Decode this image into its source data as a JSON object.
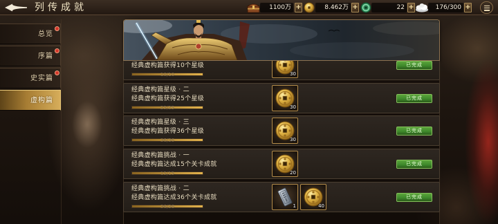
{
  "header": {
    "title": "列传成就",
    "back_icon": "back-arrow-icon",
    "menu_icon": "menu-icon",
    "plus_label": "+",
    "resources": [
      {
        "icon": "chest-icon",
        "value": "1100万"
      },
      {
        "icon": "gold-coin-icon",
        "value": "8.462万"
      },
      {
        "icon": "jade-icon",
        "value": "22"
      },
      {
        "icon": "provisions-icon",
        "value": "176/300"
      }
    ]
  },
  "sidebar": {
    "selected_index": 3,
    "tabs": [
      {
        "label": "总览",
        "has_notification": true
      },
      {
        "label": "序篇",
        "has_notification": true
      },
      {
        "label": "史实篇",
        "has_notification": true
      },
      {
        "label": "虚构篇",
        "has_notification": false
      }
    ]
  },
  "banner": {
    "icon": "hero-portrait"
  },
  "achievements": [
    {
      "description": "经典虚构篇获得10个星级",
      "progress": "10/10",
      "progress_fraction": 1,
      "rewards": [
        {
          "icon": "coin-icon",
          "count": "30"
        }
      ],
      "status": "已完成"
    },
    {
      "title": "经典虚构篇星级 · 二",
      "description": "经典虚构篇获得25个星级",
      "progress": "25/25",
      "progress_fraction": 1,
      "rewards": [
        {
          "icon": "coin-icon",
          "count": "30"
        }
      ],
      "status": "已完成"
    },
    {
      "title": "经典虚构篇星级 · 三",
      "description": "经典虚构篇获得36个星级",
      "progress": "36/36",
      "progress_fraction": 1,
      "rewards": [
        {
          "icon": "coin-icon",
          "count": "30"
        }
      ],
      "status": "已完成"
    },
    {
      "title": "经典虚构篇挑战 · 一",
      "description": "经典虚构篇达成15个关卡成就",
      "progress": "15/15",
      "progress_fraction": 1,
      "rewards": [
        {
          "icon": "coin-icon",
          "count": "20"
        }
      ],
      "status": "已完成"
    },
    {
      "title": "经典虚构篇挑战 · 二",
      "description": "经典虚构篇达成36个关卡成就",
      "progress": "36/36",
      "progress_fraction": 1,
      "rewards": [
        {
          "icon": "token-icon",
          "count": "1"
        },
        {
          "icon": "coin-icon",
          "count": "40"
        }
      ],
      "status": "已完成"
    }
  ],
  "colors": {
    "accent_gold": "#d8a84a",
    "complete_green": "#3f8a2c",
    "notification_red": "#d4372a",
    "text_light": "#e8dcc0"
  }
}
